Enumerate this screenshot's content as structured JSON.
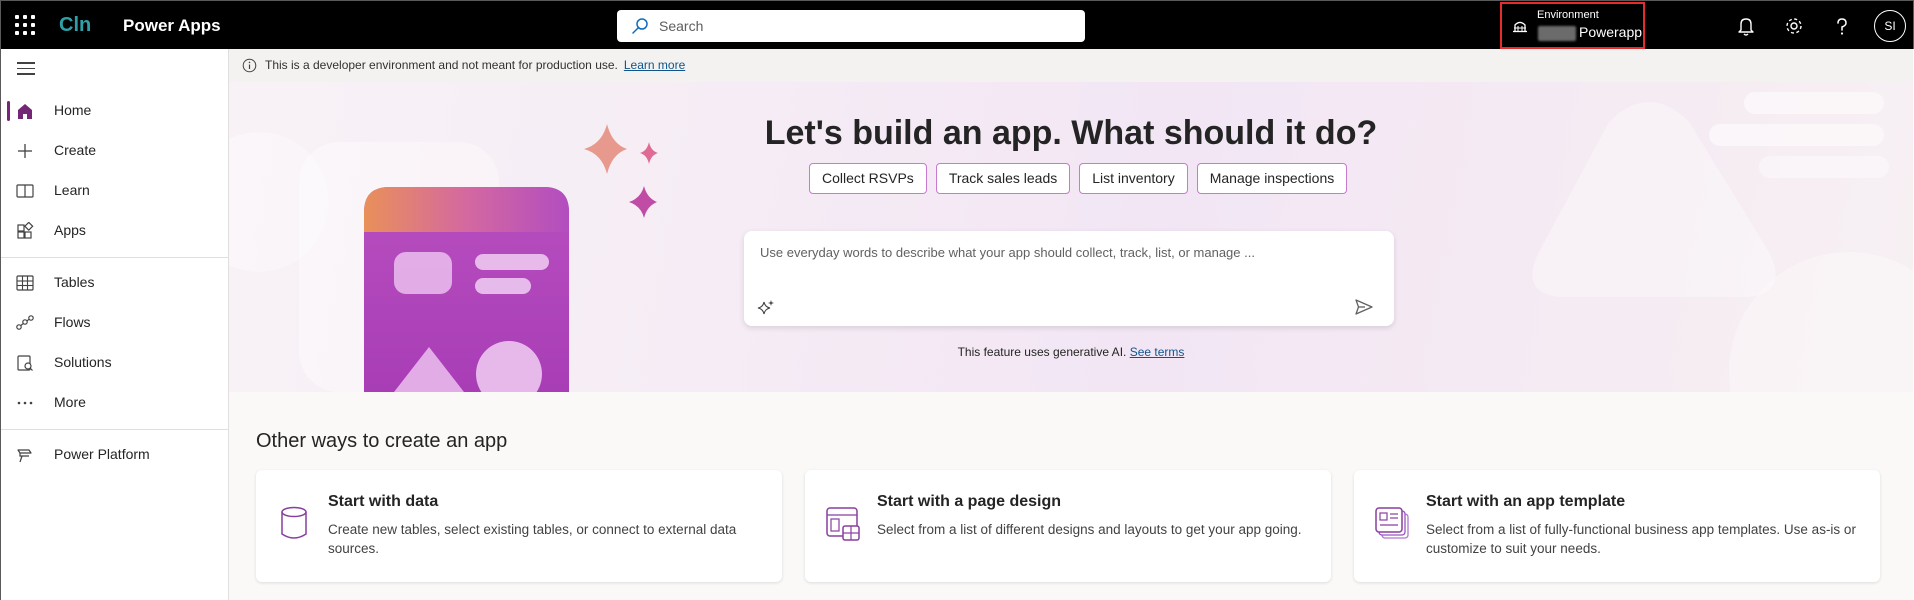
{
  "topbar": {
    "org": "Cln",
    "app_name": "Power Apps",
    "search_placeholder": "Search",
    "environment_label": "Environment",
    "environment_value": "Powerapp",
    "avatar_initials": "SI"
  },
  "nav": {
    "items": [
      {
        "label": "Home",
        "icon": "home-icon"
      },
      {
        "label": "Create",
        "icon": "plus-icon"
      },
      {
        "label": "Learn",
        "icon": "book-icon"
      },
      {
        "label": "Apps",
        "icon": "apps-icon"
      },
      {
        "label": "Tables",
        "icon": "table-icon"
      },
      {
        "label": "Flows",
        "icon": "flow-icon"
      },
      {
        "label": "Solutions",
        "icon": "solutions-icon"
      },
      {
        "label": "More",
        "icon": "more-icon"
      },
      {
        "label": "Power Platform",
        "icon": "power-platform-icon"
      }
    ]
  },
  "notice": {
    "text": "This is a developer environment and not meant for production use.",
    "link": "Learn more"
  },
  "hero": {
    "title": "Let's build an app. What should it do?",
    "chips": [
      "Collect RSVPs",
      "Track sales leads",
      "List inventory",
      "Manage inspections"
    ],
    "prompt_placeholder": "Use everyday words to describe what your app should collect, track, list, or manage ...",
    "ai_note": "This feature uses generative AI.",
    "ai_link": "See terms"
  },
  "other": {
    "title": "Other ways to create an app",
    "cards": [
      {
        "title": "Start with data",
        "desc": "Create new tables, select existing tables, or connect to external data sources.",
        "icon": "database-icon"
      },
      {
        "title": "Start with a page design",
        "desc": "Select from a list of different designs and layouts to get your app going.",
        "icon": "page-design-icon"
      },
      {
        "title": "Start with an app template",
        "desc": "Select from a list of fully-functional business app templates. Use as-is or customize to suit your needs.",
        "icon": "template-icon"
      }
    ]
  },
  "colors": {
    "accent": "#742774",
    "chip_border": "#c77bd0",
    "env_highlight": "#e52b2b",
    "link": "#0f548c"
  }
}
